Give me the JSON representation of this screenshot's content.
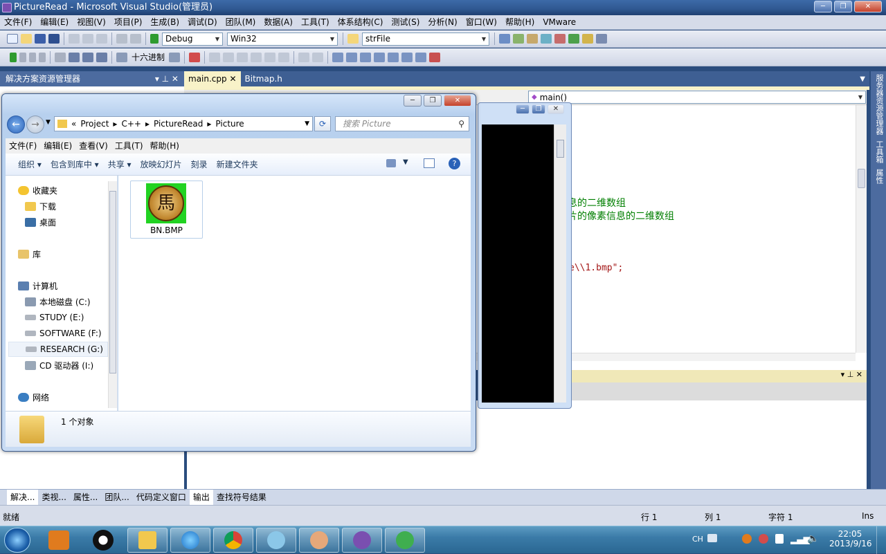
{
  "vs": {
    "title": "PictureRead - Microsoft Visual Studio(管理员)",
    "menu": [
      "文件(F)",
      "编辑(E)",
      "视图(V)",
      "项目(P)",
      "生成(B)",
      "调试(D)",
      "团队(M)",
      "数据(A)",
      "工具(T)",
      "体系结构(C)",
      "测试(S)",
      "分析(N)",
      "窗口(W)",
      "帮助(H)",
      "VMware"
    ],
    "toolbar": {
      "config": "Debug",
      "platform": "Win32",
      "find_value": "strFile",
      "hex_label": "十六进制"
    },
    "solution_panel_title": "解决方案资源管理器",
    "tabs": [
      "main.cpp",
      "Bitmap.h"
    ],
    "nav_function": "main()",
    "code_lines": [
      {
        "text": "息的二维数组",
        "color": "#007f00"
      },
      {
        "text": "片的像素信息的二维数组",
        "color": "#007f00"
      },
      {
        "text": "e\\\\1.bmp\";",
        "color": "#a31515"
      }
    ],
    "right_tabs": [
      "服务器资源管理器",
      "工具箱",
      "属性"
    ],
    "bottom_tabs": [
      "解决...",
      "类视...",
      "属性...",
      "团队...",
      "代码定义窗口",
      "输出",
      "查找符号结果"
    ],
    "status": {
      "ready": "就绪",
      "line": "行 1",
      "col": "列 1",
      "char": "字符 1",
      "mode": "Ins"
    }
  },
  "explorer": {
    "breadcrumb": [
      "«",
      "Project",
      "C++",
      "PictureRead",
      "Picture"
    ],
    "search_placeholder": "搜索 Picture",
    "menu": [
      "文件(F)",
      "编辑(E)",
      "查看(V)",
      "工具(T)",
      "帮助(H)"
    ],
    "commands": [
      "组织 ▾",
      "包含到库中 ▾",
      "共享 ▾",
      "放映幻灯片",
      "刻录",
      "新建文件夹"
    ],
    "nav": [
      {
        "label": "收藏夹",
        "icon": "star-icon",
        "indent": 0
      },
      {
        "label": "下载",
        "icon": "download-folder-icon",
        "indent": 1
      },
      {
        "label": "桌面",
        "icon": "desktop-icon",
        "indent": 1
      },
      {
        "label": "库",
        "icon": "library-icon",
        "indent": 0
      },
      {
        "label": "计算机",
        "icon": "computer-icon",
        "indent": 0
      },
      {
        "label": "本地磁盘 (C:)",
        "icon": "drive-icon",
        "indent": 1
      },
      {
        "label": "STUDY (E:)",
        "icon": "drive-icon",
        "indent": 1
      },
      {
        "label": "SOFTWARE (F:)",
        "icon": "drive-icon",
        "indent": 1
      },
      {
        "label": "RESEARCH (G:)",
        "icon": "drive-icon",
        "indent": 1
      },
      {
        "label": "CD 驱动器 (I:)",
        "icon": "cd-drive-icon",
        "indent": 1
      },
      {
        "label": "网络",
        "icon": "network-icon",
        "indent": 0
      }
    ],
    "file": {
      "name": "BN.BMP",
      "glyph": "馬"
    },
    "status_text": "1 个对象"
  },
  "taskbar": {
    "lang": "CH",
    "time": "22:05",
    "date": "2013/9/16",
    "apps": [
      "start-orb-icon",
      "media-player-icon",
      "qq-icon",
      "explorer-icon",
      "ie-icon",
      "chrome-icon",
      "search-tool-icon",
      "contacts-icon",
      "vs-icon",
      "app-icon"
    ]
  },
  "colors": {
    "vs_blue": "#4c6b9f",
    "taskbar": "#3b7ba8",
    "code_green": "#007f00",
    "code_string": "#a31515"
  }
}
